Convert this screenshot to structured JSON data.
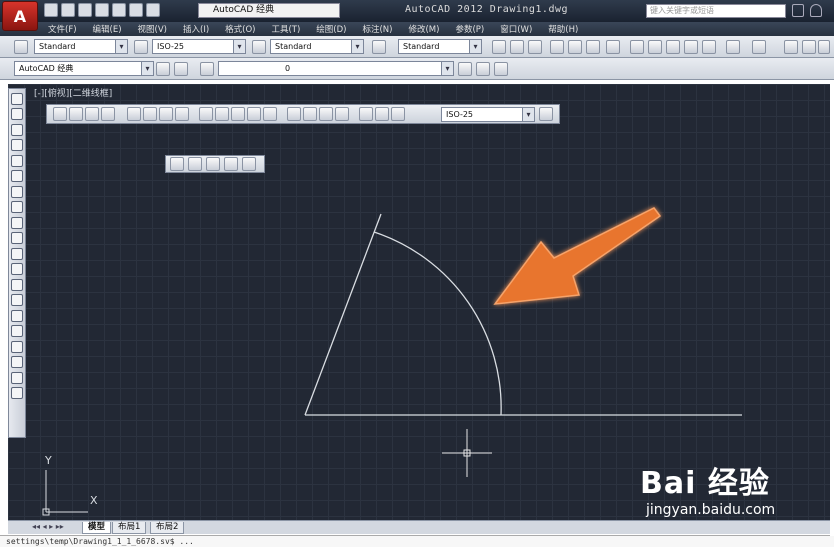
{
  "app": {
    "logo_letter": "A",
    "workspace": "AutoCAD 经典",
    "title": "AutoCAD 2012    Drawing1.dwg",
    "search_placeholder": "键入关键字或短语"
  },
  "menu": [
    "文件(F)",
    "编辑(E)",
    "视图(V)",
    "插入(I)",
    "格式(O)",
    "工具(T)",
    "绘图(D)",
    "标注(N)",
    "修改(M)",
    "参数(P)",
    "窗口(W)",
    "帮助(H)"
  ],
  "toolbar1": {
    "text_style": "Standard",
    "dim_style": "ISO-25",
    "table_style": "Standard",
    "mleader_style": "Standard"
  },
  "toolbar2": {
    "workspace": "AutoCAD 经典",
    "layer": "0"
  },
  "viewport": {
    "label": "[-][俯视][二维线框]",
    "dim_style": "ISO-25"
  },
  "ucs": {
    "y_label": "Y",
    "x_label": "X"
  },
  "tabs": [
    "模型",
    "布局1",
    "布局2"
  ],
  "command_line": "settings\\temp\\Drawing1_1_1_6678.sv$ ...",
  "watermark": {
    "brand": "Bai 经验",
    "site": "jingyan.baidu.com"
  },
  "colors": {
    "drawing_bg": "#222834",
    "arrow": "#e8742e",
    "lines": "#d9dde2"
  }
}
